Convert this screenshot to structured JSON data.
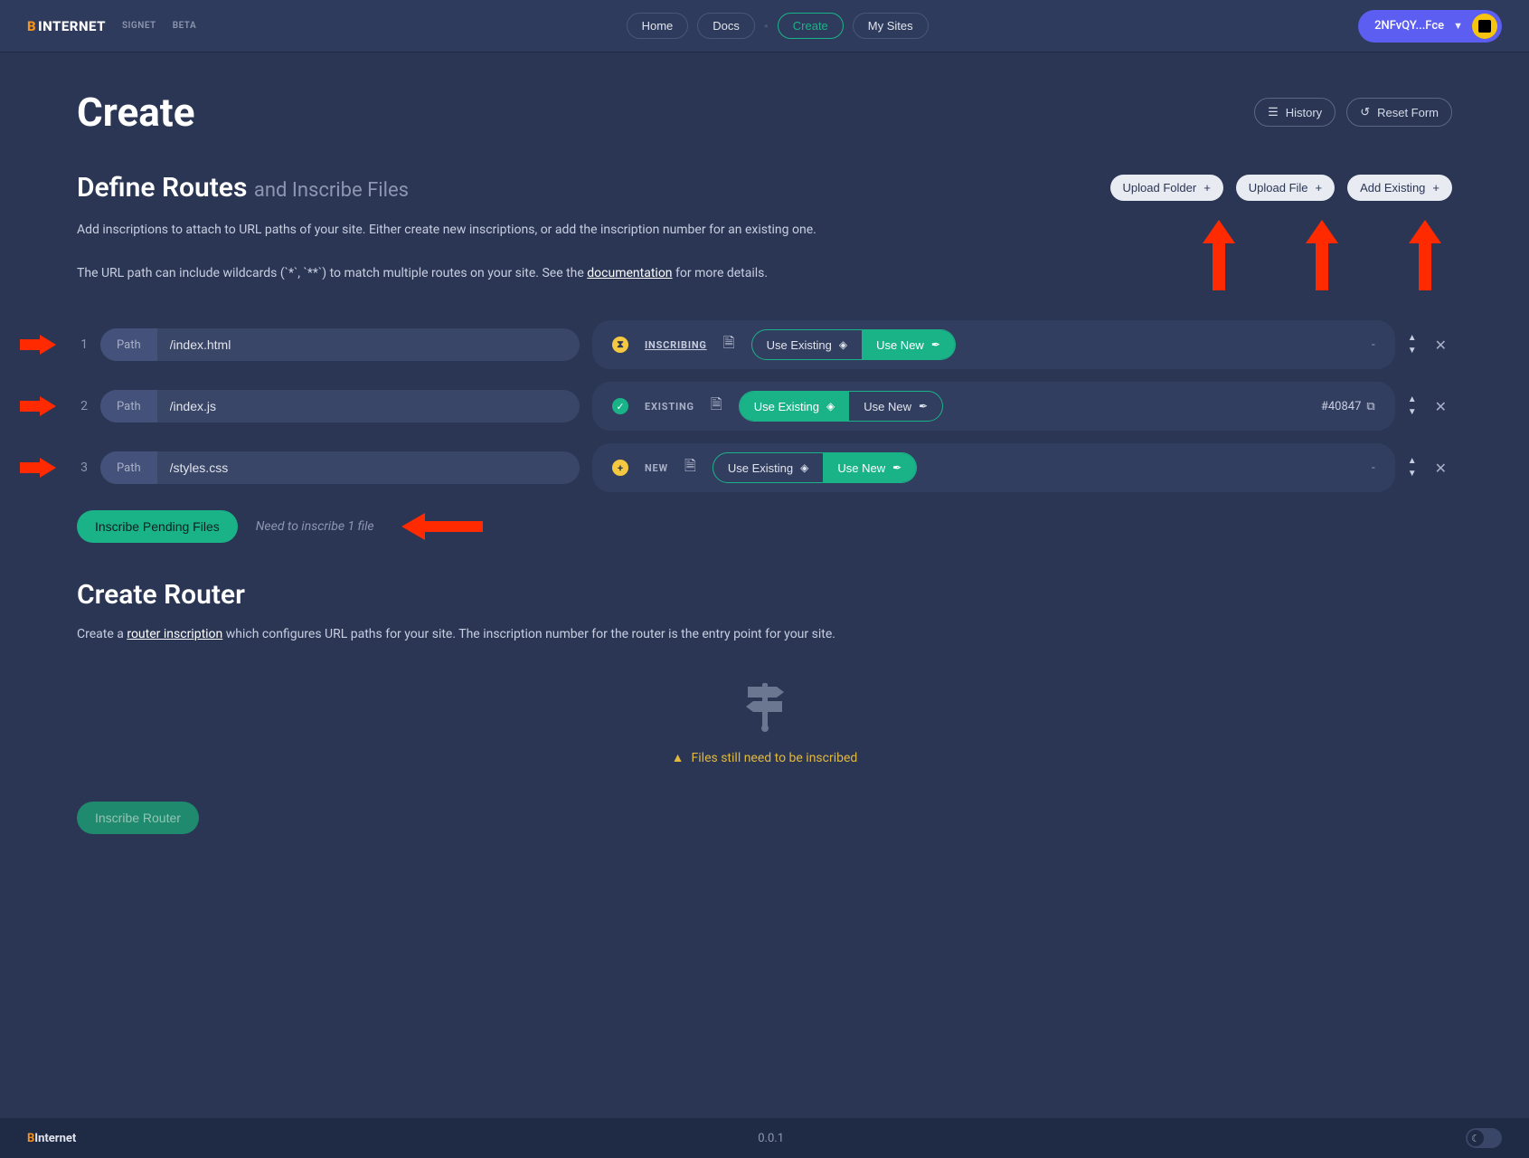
{
  "brand": {
    "b": "B",
    "rest": "INTERNET",
    "tag1": "SIGNET",
    "tag2": "BETA"
  },
  "nav": {
    "home": "Home",
    "docs": "Docs",
    "create": "Create",
    "mysites": "My Sites"
  },
  "wallet": {
    "addr": "2NFvQY...Fce"
  },
  "page": {
    "title": "Create",
    "history": "History",
    "reset": "Reset Form"
  },
  "routes": {
    "title": "Define Routes",
    "subtitle": "and Inscribe Files",
    "uploadFolder": "Upload Folder",
    "uploadFile": "Upload File",
    "addExisting": "Add Existing",
    "desc1": "Add inscriptions to attach to URL paths of your site. Either create new inscriptions, or add the inscription number for an existing one.",
    "desc2a": "The URL path can include wildcards (`*`, `**`) to match multiple routes on your site. See the ",
    "desc2link": "documentation",
    "desc2b": " for more details.",
    "pathLabel": "Path",
    "useExisting": "Use Existing",
    "useNew": "Use New",
    "rows": [
      {
        "num": "1",
        "path": "/index.html",
        "status": "INSCRIBING",
        "mode": "new",
        "insc": "-"
      },
      {
        "num": "2",
        "path": "/index.js",
        "status": "EXISTING",
        "mode": "existing",
        "insc": "#40847"
      },
      {
        "num": "3",
        "path": "/styles.css",
        "status": "NEW",
        "mode": "new",
        "insc": "-"
      }
    ],
    "inscribePending": "Inscribe Pending Files",
    "pendingHint": "Need to inscribe 1 file"
  },
  "router": {
    "title": "Create Router",
    "desc1": "Create a ",
    "descLink": "router inscription",
    "desc2": " which configures URL paths for your site. The inscription number for the router is the entry point for your site.",
    "warn": "Files still need to be inscribed",
    "button": "Inscribe Router"
  },
  "footer": {
    "b": "B",
    "rest": "Internet",
    "version": "0.0.1"
  }
}
